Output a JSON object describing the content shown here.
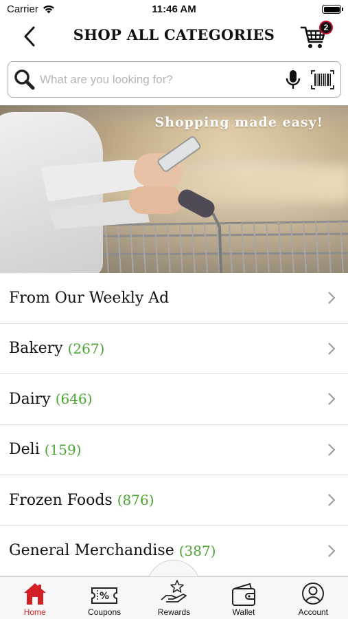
{
  "status_bar": {
    "carrier": "Carrier",
    "time": "11:46 AM"
  },
  "header": {
    "title": "SHOP ALL CATEGORIES",
    "cart_count": "2"
  },
  "search": {
    "placeholder": "What are you looking for?",
    "value": ""
  },
  "banner": {
    "tagline": "Shopping made easy!"
  },
  "categories": [
    {
      "label": "From Our Weekly Ad",
      "count": ""
    },
    {
      "label": "Bakery",
      "count": "(267)"
    },
    {
      "label": "Dairy",
      "count": "(646)"
    },
    {
      "label": "Deli",
      "count": "(159)"
    },
    {
      "label": "Frozen Foods",
      "count": "(876)"
    },
    {
      "label": "General Merchandise",
      "count": "(387)"
    }
  ],
  "tabs": [
    {
      "label": "Home",
      "icon": "home-icon",
      "active": true
    },
    {
      "label": "Coupons",
      "icon": "coupon-icon",
      "active": false
    },
    {
      "label": "Rewards",
      "icon": "rewards-icon",
      "active": false
    },
    {
      "label": "Wallet",
      "icon": "wallet-icon",
      "active": false
    },
    {
      "label": "Account",
      "icon": "account-icon",
      "active": false
    }
  ],
  "colors": {
    "accent": "#d32027",
    "count_green": "#4aa52e",
    "badge_ring": "#c8102e"
  }
}
